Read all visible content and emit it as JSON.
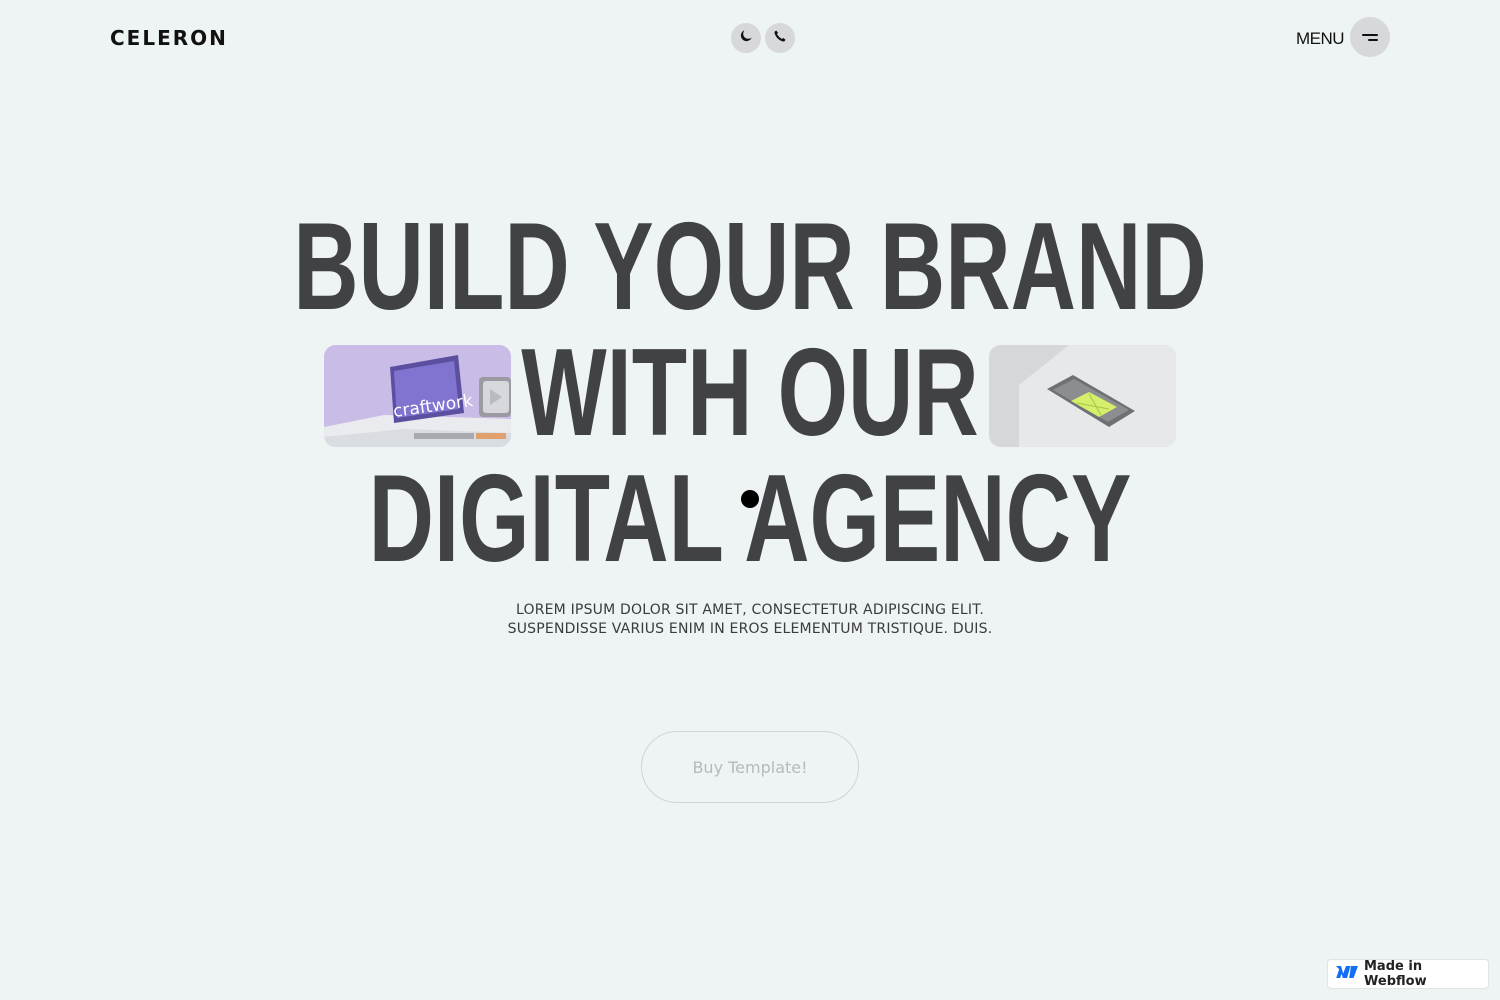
{
  "header": {
    "logo": "CELERON",
    "icons": [
      "moon-icon",
      "phone-icon"
    ],
    "menu_label": "MENU",
    "menu_icon": "hamburger-icon"
  },
  "hero": {
    "headline": [
      "BUILD YOUR BRAND",
      "WITH OUR",
      "DIGITAL AGENCY"
    ],
    "thumb_left_text": "craftwork",
    "subtitle": [
      "LOREM IPSUM DOLOR SIT AMET, CONSECTETUR ADIPISCING ELIT.",
      "SUSPENDISSE VARIUS ENIM IN EROS ELEMENTUM TRISTIQUE. DUIS."
    ],
    "cta_label": "Buy Template!"
  },
  "badge": {
    "label": "Made in Webflow",
    "icon": "webflow-icon"
  },
  "colors": {
    "background": "#eef3f3",
    "headline": "#414246",
    "accent_purple": "#c9bce6",
    "accent_lime": "#d4f06a"
  }
}
